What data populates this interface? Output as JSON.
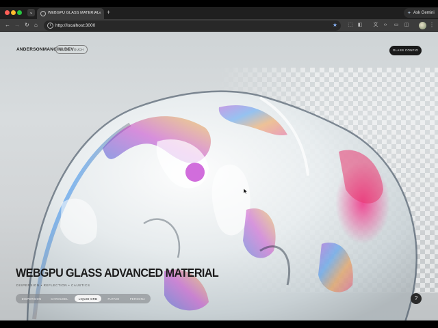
{
  "browser": {
    "tab_title": "WEBGPU GLASS MATERIAL",
    "tab_close": "×",
    "new_tab": "+",
    "ask_label": "Ask Gemini",
    "url": "http://localhost:3000"
  },
  "icons": [
    "tab-list-icon",
    "close-icon",
    "plus-icon",
    "back-icon",
    "forward-icon",
    "reload-icon",
    "home-icon",
    "site-info-icon",
    "bookmark-star-icon",
    "extensions-icon",
    "translate-icon",
    "devtools-icon",
    "cast-icon",
    "sidebar-icon",
    "profile-avatar-icon",
    "menu-dots-icon",
    "help-icon",
    "cursor-icon"
  ],
  "site": {
    "logo": "ANDERSONMANCINI.DEV",
    "contact_button": "GET IN TOUCH",
    "config_button": "GLASS CONFIG",
    "headline": "WEBGPU GLASS ADVANCED MATERIAL",
    "subheadline": "DISPERSION • REFLECTION • CAUSTICS",
    "tabs": [
      {
        "label": "DISPERSION",
        "active": false
      },
      {
        "label": "CAROUSEL",
        "active": false
      },
      {
        "label": "LIQUID ORB",
        "active": true
      },
      {
        "label": "FUTAMI",
        "active": false
      },
      {
        "label": "PERSONA",
        "active": false
      }
    ],
    "help_button": "?"
  }
}
